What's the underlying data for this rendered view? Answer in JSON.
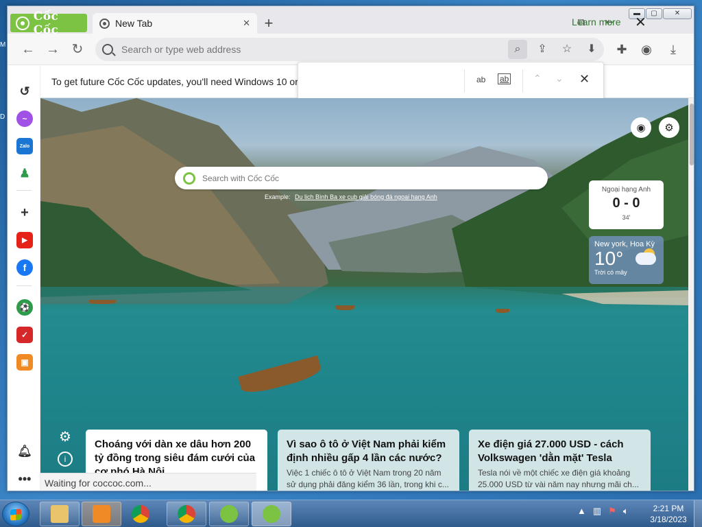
{
  "browser": {
    "brand": "Cốc Cốc",
    "tab_title": "New Tab",
    "address_placeholder": "Search or type web address"
  },
  "infobar": {
    "message": "To get future Cốc Cốc updates, you'll need Windows 10 or",
    "learn_more": "Learn more"
  },
  "findbar": {
    "match_case": "ab",
    "whole_word": "ab"
  },
  "newtab": {
    "search_placeholder": "Search with Cốc Cốc",
    "example_label": "Example:",
    "example_link": "Du lịch Bình Ba xe cub giải bóng đá ngoại hạng Anh",
    "score": {
      "league": "Ngoại hạng Anh",
      "result": "0 - 0",
      "minute": "34'"
    },
    "weather": {
      "city": "New york, Hoa Kỳ",
      "temp": "10°",
      "desc": "Trời có mây"
    },
    "news": [
      {
        "title": "Choáng với dàn xe dâu hơn 200 tỷ đồng trong siêu đám cưới của cơ phó Hà Nội",
        "snippet": ""
      },
      {
        "title": "Vì sao ô tô ở Việt Nam phải kiểm định nhiều gấp 4 lần các nước?",
        "snippet": "Việc 1 chiếc ô tô ở Việt Nam trong 20 năm sử dụng phải đăng kiểm 36 lần, trong khi c..."
      },
      {
        "title": "Xe điện giá 27.000 USD - cách Volkswagen 'dằn mặt' Tesla",
        "snippet": "Tesla nói về một chiếc xe điện giá khoảng 25.000 USD từ vài năm nay nhưng mãi ch..."
      }
    ]
  },
  "status": "Waiting for coccoc.com...",
  "taskbar": {
    "time": "2:21 PM",
    "date": "3/18/2023"
  },
  "colors": {
    "brand_green": "#7cc243",
    "learn_more": "#2d7a2a"
  }
}
